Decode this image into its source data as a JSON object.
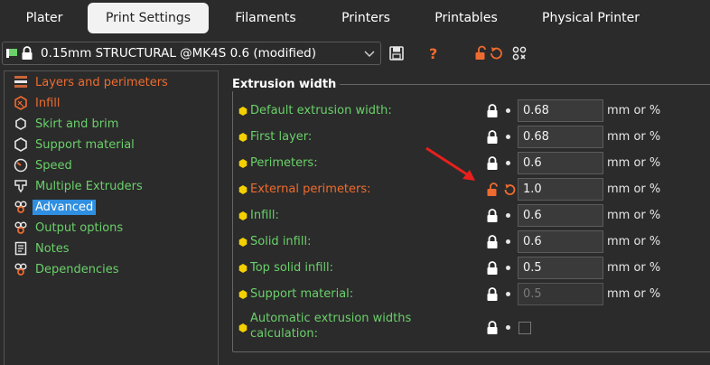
{
  "tabs": [
    {
      "label": "Plater",
      "active": false
    },
    {
      "label": "Print Settings",
      "active": true
    },
    {
      "label": "Filaments",
      "active": false
    },
    {
      "label": "Printers",
      "active": false
    },
    {
      "label": "Printables",
      "active": false
    },
    {
      "label": "Physical Printer",
      "active": false
    }
  ],
  "preset": {
    "name": "0.15mm STRUCTURAL @MK4S 0.6 (modified)"
  },
  "nav": [
    {
      "label": "Layers and perimeters",
      "icon": "layers-icon",
      "state": "modified"
    },
    {
      "label": "Infill",
      "icon": "infill-icon",
      "state": "modified"
    },
    {
      "label": "Skirt and brim",
      "icon": "skirt-icon",
      "state": "normal"
    },
    {
      "label": "Support material",
      "icon": "support-icon",
      "state": "normal"
    },
    {
      "label": "Speed",
      "icon": "speed-icon",
      "state": "normal"
    },
    {
      "label": "Multiple Extruders",
      "icon": "extruder-icon",
      "state": "normal"
    },
    {
      "label": "Advanced",
      "icon": "advanced-icon",
      "state": "selected"
    },
    {
      "label": "Output options",
      "icon": "output-icon",
      "state": "normal"
    },
    {
      "label": "Notes",
      "icon": "notes-icon",
      "state": "normal"
    },
    {
      "label": "Dependencies",
      "icon": "dependencies-icon",
      "state": "normal"
    }
  ],
  "section": {
    "title": "Extrusion width",
    "rows": [
      {
        "label": "Default extrusion width:",
        "value": "0.68",
        "unit": "mm or %"
      },
      {
        "label": "First layer:",
        "value": "0.68",
        "unit": "mm or %"
      },
      {
        "label": "Perimeters:",
        "value": "0.6",
        "unit": "mm or %"
      },
      {
        "label": "External perimeters:",
        "value": "1.0",
        "unit": "mm or %"
      },
      {
        "label": "Infill:",
        "value": "0.6",
        "unit": "mm or %"
      },
      {
        "label": "Solid infill:",
        "value": "0.6",
        "unit": "mm or %"
      },
      {
        "label": "Top solid infill:",
        "value": "0.5",
        "unit": "mm or %"
      },
      {
        "label": "Support material:",
        "value": "0.5",
        "unit": "mm or %"
      },
      {
        "label_line1": "Automatic extrusion widths",
        "label_line2": "calculation:"
      }
    ]
  },
  "colors": {
    "modified": "#ee6b2f",
    "system": "#6ad06a",
    "selected": "#2f8fe0",
    "bullet": "#f5d000"
  }
}
